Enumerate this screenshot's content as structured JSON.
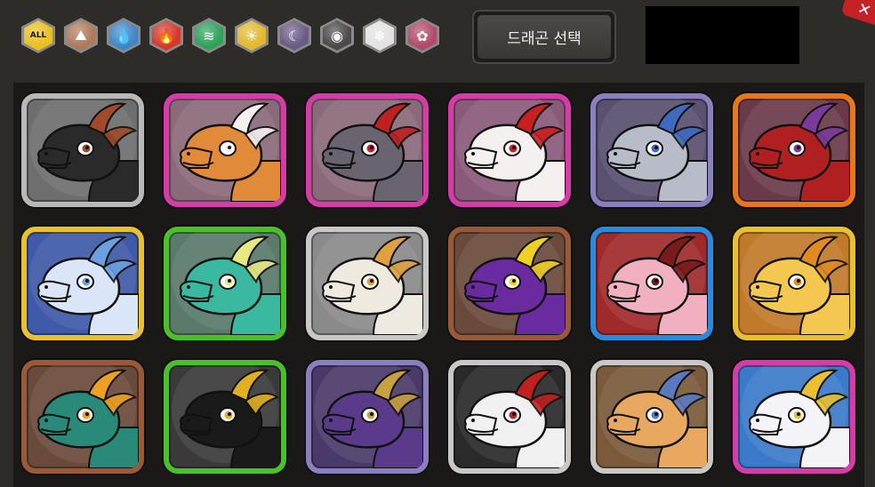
{
  "filters": [
    {
      "icon": "all-icon",
      "label": "ALL",
      "color": "#e8c020"
    },
    {
      "icon": "earth-element-icon",
      "color": "#b07a5a"
    },
    {
      "icon": "water-element-icon",
      "color": "#3e86c8"
    },
    {
      "icon": "fire-element-icon",
      "color": "#d2392b"
    },
    {
      "icon": "wind-element-icon",
      "color": "#2ea25a"
    },
    {
      "icon": "light-element-icon",
      "color": "#e2b830"
    },
    {
      "icon": "dark-element-icon",
      "color": "#6a5a86"
    },
    {
      "icon": "chaos-element-icon",
      "color": "#4a4a4a"
    },
    {
      "icon": "ice-element-icon",
      "color": "#e2e2e2"
    },
    {
      "icon": "poison-element-icon",
      "color": "#b24a6a"
    }
  ],
  "select_button": {
    "label": "드래곤 선택"
  },
  "dragons": [
    {
      "icon": "black-dragon-portrait-icon",
      "frame": "#b8b8b8",
      "bg": "#6e6e6e",
      "body": "#2a2a2a",
      "accent": "#a04a2a"
    },
    {
      "icon": "orange-white-dragon-portrait-icon",
      "frame": "#d83aa8",
      "bg": "#8a6a7a",
      "body": "#e08a3a",
      "accent": "#f4f0f0"
    },
    {
      "icon": "gray-horned-dragon-portrait-icon",
      "frame": "#d83aa8",
      "bg": "#8a6a7a",
      "body": "#6a6470",
      "accent": "#c02020"
    },
    {
      "icon": "white-red-dragon-portrait-icon",
      "frame": "#d83aa8",
      "bg": "#8a5a7a",
      "body": "#f4f0f0",
      "accent": "#c82020"
    },
    {
      "icon": "armored-skull-dragon-portrait-icon",
      "frame": "#8a80c0",
      "bg": "#5a5070",
      "body": "#b8bcc8",
      "accent": "#3e6ac0"
    },
    {
      "icon": "red-purple-dragon-portrait-icon",
      "frame": "#e8761a",
      "bg": "#6a3a4a",
      "body": "#b02020",
      "accent": "#7a3a9a"
    },
    {
      "icon": "ice-blue-dragon-portrait-icon",
      "frame": "#e8c030",
      "bg": "#3e5aa8",
      "body": "#dae6f8",
      "accent": "#6aa0e0"
    },
    {
      "icon": "teal-dragon-portrait-icon",
      "frame": "#4ac02a",
      "bg": "#5a7a6a",
      "body": "#3ab8a0",
      "accent": "#e8e880"
    },
    {
      "icon": "white-gold-dragon-portrait-icon",
      "frame": "#c8c8c8",
      "bg": "#8a8a8a",
      "body": "#eeeae0",
      "accent": "#e0a040"
    },
    {
      "icon": "purple-serpent-dragon-portrait-icon",
      "frame": "#9a5a3a",
      "bg": "#6a4a3a",
      "body": "#6a2aa0",
      "accent": "#f0d020"
    },
    {
      "icon": "pink-dragon-portrait-icon",
      "frame": "#2a8ae0",
      "bg": "#a02a2a",
      "body": "#f0b0c0",
      "accent": "#7a1a1a"
    },
    {
      "icon": "yellow-dragon-portrait-icon",
      "frame": "#e8c030",
      "bg": "#c07a2a",
      "body": "#f4c850",
      "accent": "#e08a20"
    },
    {
      "icon": "green-dragon-portrait-icon",
      "frame": "#9a5a3a",
      "bg": "#6a4a3a",
      "body": "#2a8a7a",
      "accent": "#f0a020"
    },
    {
      "icon": "black-gold-dragon-portrait-icon",
      "frame": "#4ac02a",
      "bg": "#3a3a3a",
      "body": "#1a1a1a",
      "accent": "#e0b020"
    },
    {
      "icon": "violet-horned-dragon-portrait-icon",
      "frame": "#8a80c0",
      "bg": "#4a3a6a",
      "body": "#5a3a8a",
      "accent": "#c8a040"
    },
    {
      "icon": "red-white-striped-dragon-portrait-icon",
      "frame": "#c8c8c8",
      "bg": "#2a2a2a",
      "body": "#f0f0f0",
      "accent": "#c02020"
    },
    {
      "icon": "tan-furry-dragon-portrait-icon",
      "frame": "#c8c8c8",
      "bg": "#7a5a3a",
      "body": "#e8a860",
      "accent": "#5a7ac0"
    },
    {
      "icon": "white-baby-dragon-portrait-icon",
      "frame": "#d83aa8",
      "bg": "#3a7ac8",
      "body": "#f4f4f8",
      "accent": "#e8c030"
    }
  ]
}
